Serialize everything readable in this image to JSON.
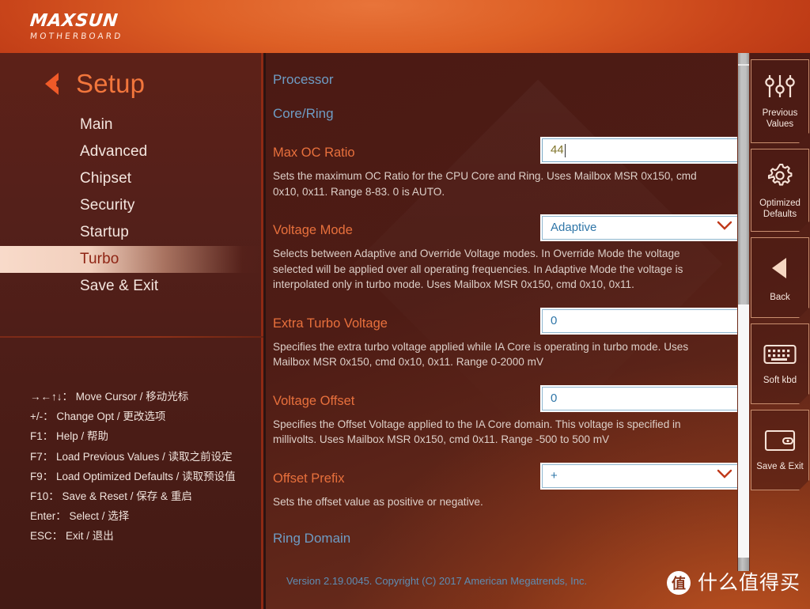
{
  "brand": {
    "logo_main": "MAXSUN",
    "logo_sub": "MOTHERBOARD"
  },
  "sidebar": {
    "setup_title": "Setup",
    "back_icon": "back-chevron-icon",
    "items": [
      {
        "label": "Main",
        "active": false
      },
      {
        "label": "Advanced",
        "active": false
      },
      {
        "label": "Chipset",
        "active": false
      },
      {
        "label": "Security",
        "active": false
      },
      {
        "label": "Startup",
        "active": false
      },
      {
        "label": "Turbo",
        "active": true
      },
      {
        "label": "Save & Exit",
        "active": false
      }
    ],
    "key_help": [
      "→←↑↓： Move Cursor  /  移动光标",
      "+/-： Change Opt  /  更改选项",
      "F1： Help  /  帮助",
      "F7： Load Previous Values  /  读取之前设定",
      "F9： Load Optimized Defaults  /  读取预设值",
      "F10： Save & Reset  /  保存 & 重启",
      "Enter： Select  /  选择",
      "ESC： Exit  /  退出"
    ]
  },
  "main": {
    "section_processor": "Processor",
    "section_core_ring": "Core/Ring",
    "section_ring_domain": "Ring Domain",
    "fields": [
      {
        "label": "Max OC Ratio",
        "value": "44",
        "type": "text",
        "editing": true,
        "description": "Sets the maximum OC Ratio for the CPU Core and Ring. Uses Mailbox MSR 0x150, cmd 0x10, 0x11. Range 8-83. 0 is AUTO."
      },
      {
        "label": "Voltage Mode",
        "value": "Adaptive",
        "type": "select",
        "editing": false,
        "description": "Selects between Adaptive and Override Voltage modes. In Override Mode the voltage selected will be applied over all operating frequencies. In Adaptive Mode the voltage is interpolated only in turbo mode. Uses Mailbox MSR 0x150, cmd 0x10, 0x11."
      },
      {
        "label": "Extra Turbo Voltage",
        "value": "0",
        "type": "text",
        "editing": false,
        "description": "Specifies the extra turbo voltage applied while IA Core is operating in turbo mode. Uses Mailbox MSR 0x150, cmd 0x10, 0x11. Range 0-2000 mV"
      },
      {
        "label": "Voltage Offset",
        "value": "0",
        "type": "text",
        "editing": false,
        "description": "Specifies the Offset Voltage applied to the IA Core domain. This voltage is specified in millivolts. Uses Mailbox MSR 0x150, cmd 0x11. Range -500 to 500 mV"
      },
      {
        "label": "Offset Prefix",
        "value": "+",
        "type": "select",
        "editing": false,
        "description": "Sets the offset value as positive or negative."
      }
    ]
  },
  "right_panel": {
    "buttons": [
      {
        "label": "Previous\nValues",
        "label_line1": "Previous",
        "label_line2": "Values",
        "icon": "sliders-icon"
      },
      {
        "label": "Optimized\nDefaults",
        "label_line1": "Optimized",
        "label_line2": "Defaults",
        "icon": "gear-icon"
      },
      {
        "label": "Back",
        "label_line1": "Back",
        "label_line2": "",
        "icon": "back-triangle-icon"
      },
      {
        "label": "Soft kbd",
        "label_line1": "Soft kbd",
        "label_line2": "",
        "icon": "keyboard-icon"
      },
      {
        "label": "Save & Exit",
        "label_line1": "Save & Exit",
        "label_line2": "",
        "icon": "exit-door-icon"
      }
    ]
  },
  "footer": {
    "version": "Version 2.19.0045. Copyright (C) 2017 American Megatrends, Inc."
  },
  "watermark": {
    "badge": "值",
    "text": "什么值得买"
  },
  "colors": {
    "accent_orange": "#e8703c",
    "section_blue": "#6e9cc4",
    "header_orange": "#dd5f25",
    "sidebar_brown": "#54201a"
  },
  "scrollbar": {
    "thumb_top_percent": 0,
    "thumb_height_percent": 48
  }
}
